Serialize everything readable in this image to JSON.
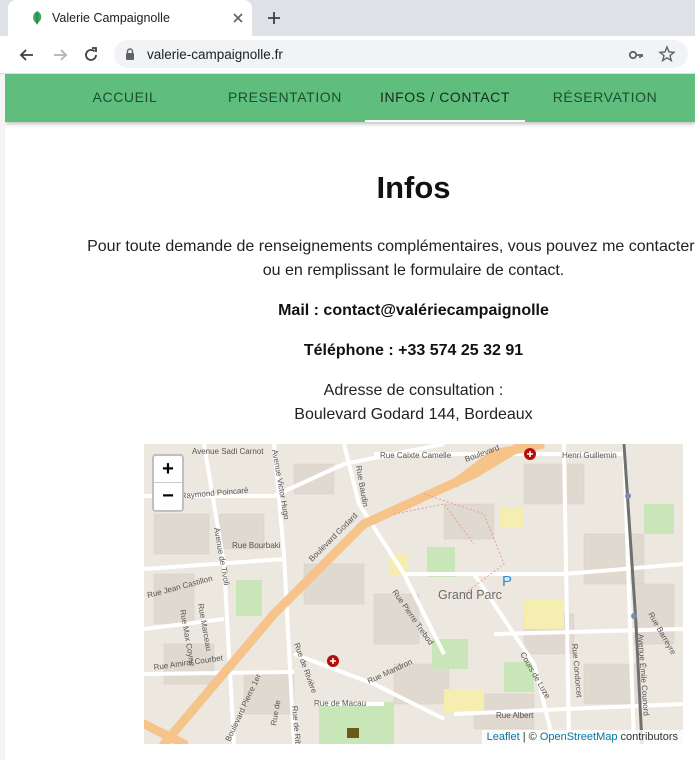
{
  "browser": {
    "tab_title": "Valerie Campaignolle",
    "url": "valerie-campaignolle.fr"
  },
  "site_nav": {
    "items": [
      {
        "label": "ACCUEIL"
      },
      {
        "label": "PRESENTATION"
      },
      {
        "label": "INFOS / CONTACT",
        "active": true
      },
      {
        "label": "RÉSERVATION"
      }
    ]
  },
  "content": {
    "heading": "Infos",
    "intro_line1": "Pour toute demande de renseignements complémentaires, vous pouvez me contacter par té",
    "intro_line2": "ou en remplissant le formulaire de contact.",
    "mail": "Mail : contact@valériecampaignolle",
    "phone": "Téléphone : +33 574 25 32 91",
    "address_label": "Adresse de consultation :",
    "address": "Boulevard Godard 144, Bordeaux"
  },
  "map": {
    "zoom_in": "+",
    "zoom_out": "−",
    "place_label": "Grand Parc",
    "parking_label": "P",
    "streets": [
      "Avenue Sadi Carnot",
      "Rue Caixte Camelle",
      "Boulevard",
      "Henri Guillemin",
      "Rue Raymond Poincaré",
      "Avenue Victor Hugo",
      "Rue Baudin",
      "Boulevard Godard",
      "Rue Bourbaki",
      "Avenue de Tivoli",
      "Rue Jean Castillon",
      "Rue Marceau",
      "Rue Max Coyne",
      "Rue Amiral Courbet",
      "Boulevard Pierre 1er",
      "Rue de Rivière",
      "Rue de Macau",
      "Rue Mandron",
      "Rue Pierre Trebod",
      "Cours de Luze",
      "Rue Condorcet",
      "Rue Albert",
      "Rue de Ribérac",
      "Avenue Émile Counord",
      "Rue Barreyre",
      "Rue de"
    ],
    "attribution_leaflet": "Leaflet",
    "attribution_sep": " | © ",
    "attribution_osm": "OpenStreetMap",
    "attribution_tail": " contributors"
  },
  "colors": {
    "nav_bg": "#5fbd7d",
    "nav_text": "#1d4e31",
    "map_road_major": "#f6c38a",
    "map_park": "#c8e6b8"
  }
}
